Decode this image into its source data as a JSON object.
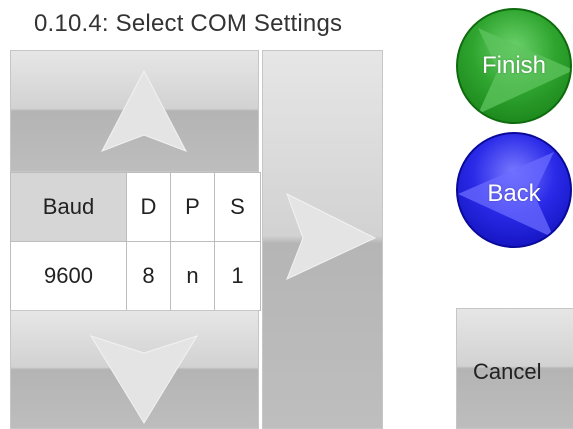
{
  "title": "0.10.4: Select COM Settings",
  "table": {
    "headers": [
      "Baud",
      "D",
      "P",
      "S"
    ],
    "values": [
      "9600",
      "8",
      "n",
      "1"
    ]
  },
  "buttons": {
    "up": "up-arrow-icon",
    "down": "down-arrow-icon",
    "right": "right-arrow-icon",
    "finish_label": "Finish",
    "back_label": "Back",
    "cancel_label": "Cancel"
  },
  "colors": {
    "finish": "#2fa52f",
    "back": "#2a2ae8",
    "tile": "#d2d2d2"
  }
}
